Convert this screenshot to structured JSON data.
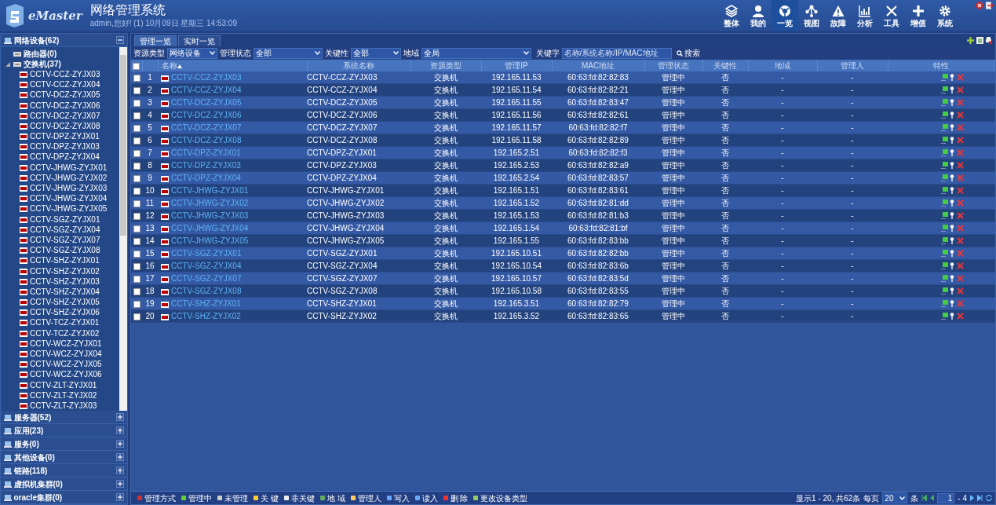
{
  "header": {
    "logo_text": "eMaster",
    "title": "网络管理系统",
    "subtitle": "admin,您好! (1) 10月09日 星期三 14:53:09",
    "nav": [
      {
        "label": "整体",
        "selected": false
      },
      {
        "label": "我的",
        "selected": false
      },
      {
        "label": "一览",
        "selected": true
      },
      {
        "label": "视图",
        "selected": false
      },
      {
        "label": "故障",
        "selected": false
      },
      {
        "label": "分析",
        "selected": false
      },
      {
        "label": "工具",
        "selected": false
      },
      {
        "label": "增值",
        "selected": false
      },
      {
        "label": "系统",
        "selected": false
      }
    ]
  },
  "sidebar": {
    "groups": [
      {
        "label": "网络设备(62)",
        "expanded": true,
        "children": [
          {
            "label": "路由器(0)",
            "expanded": false
          },
          {
            "label": "交换机(37)",
            "expanded": true,
            "children": [
              "CCTV-CCZ-ZYJX03",
              "CCTV-CCZ-ZYJX04",
              "CCTV-DCZ-ZYJX05",
              "CCTV-DCZ-ZYJX06",
              "CCTV-DCZ-ZYJX07",
              "CCTV-DCZ-ZYJX08",
              "CCTV-DPZ-ZYJX01",
              "CCTV-DPZ-ZYJX03",
              "CCTV-DPZ-ZYJX04",
              "CCTV-JHWG-ZYJX01",
              "CCTV-JHWG-ZYJX02",
              "CCTV-JHWG-ZYJX03",
              "CCTV-JHWG-ZYJX04",
              "CCTV-JHWG-ZYJX05",
              "CCTV-SGZ-ZYJX01",
              "CCTV-SGZ-ZYJX04",
              "CCTV-SGZ-ZYJX07",
              "CCTV-SGZ-ZYJX08",
              "CCTV-SHZ-ZYJX01",
              "CCTV-SHZ-ZYJX02",
              "CCTV-SHZ-ZYJX03",
              "CCTV-SHZ-ZYJX04",
              "CCTV-SHZ-ZYJX05",
              "CCTV-SHZ-ZYJX06",
              "CCTV-TCZ-ZYJX01",
              "CCTV-TCZ-ZYJX02",
              "CCTV-WCZ-ZYJX01",
              "CCTV-WCZ-ZYJX04",
              "CCTV-WCZ-ZYJX05",
              "CCTV-WCZ-ZYJX06",
              "CCTV-ZLT-ZYJX01",
              "CCTV-ZLT-ZYJX02",
              "CCTV-ZLT-ZYJX03"
            ]
          }
        ]
      },
      {
        "label": "服务器(52)",
        "expanded": false
      },
      {
        "label": "应用(23)",
        "expanded": false
      },
      {
        "label": "服务(0)",
        "expanded": false
      },
      {
        "label": "其他设备(0)",
        "expanded": false
      },
      {
        "label": "链路(118)",
        "expanded": false
      },
      {
        "label": "虚拟机集群(0)",
        "expanded": false
      },
      {
        "label": "oracle集群(0)",
        "expanded": false
      }
    ]
  },
  "tabs": [
    {
      "label": "管理一览",
      "selected": true
    },
    {
      "label": "实时一览",
      "selected": false
    }
  ],
  "filters": [
    {
      "label": "资源类型",
      "value": "网络设备"
    },
    {
      "label": "管理状态",
      "value": "全部"
    },
    {
      "label": "关键性",
      "value": "全部"
    },
    {
      "label": "地域",
      "value": "全局"
    }
  ],
  "keyword": {
    "label": "关键字",
    "placeholder": "名称/系统名称/IP/MAC地址"
  },
  "search_button": "搜索",
  "table": {
    "select_all_checked": false,
    "columns": [
      "名称",
      "系统名称",
      "资源类型",
      "管理IP",
      "MAC地址",
      "管理状态",
      "关键性",
      "地域",
      "管理人",
      "特性"
    ],
    "rows": [
      {
        "no": "1",
        "name": "CCTV-CCZ-ZYJX03",
        "sysname": "CCTV-CCZ-ZYJX03",
        "type": "交换机",
        "ip": "192.165.11.53",
        "mac": "60:63:fd:82:82:83",
        "state": "管理中",
        "key": "否",
        "region": "-",
        "manager": "-",
        "checked": false
      },
      {
        "no": "2",
        "name": "CCTV-CCZ-ZYJX04",
        "sysname": "CCTV-CCZ-ZYJX04",
        "type": "交换机",
        "ip": "192.165.11.54",
        "mac": "60:63:fd:82:82:21",
        "state": "管理中",
        "key": "否",
        "region": "-",
        "manager": "-",
        "checked": false
      },
      {
        "no": "3",
        "name": "CCTV-DCZ-ZYJX05",
        "sysname": "CCTV-DCZ-ZYJX05",
        "type": "交换机",
        "ip": "192.165.11.55",
        "mac": "60:63:fd:82:83:47",
        "state": "管理中",
        "key": "否",
        "region": "-",
        "manager": "-",
        "checked": false
      },
      {
        "no": "4",
        "name": "CCTV-DCZ-ZYJX06",
        "sysname": "CCTV-DCZ-ZYJX06",
        "type": "交换机",
        "ip": "192.165.11.56",
        "mac": "60:63:fd:82:82:61",
        "state": "管理中",
        "key": "否",
        "region": "-",
        "manager": "-",
        "checked": false
      },
      {
        "no": "5",
        "name": "CCTV-DCZ-ZYJX07",
        "sysname": "CCTV-DCZ-ZYJX07",
        "type": "交换机",
        "ip": "192.165.11.57",
        "mac": "60:63:fd:82:82:f7",
        "state": "管理中",
        "key": "否",
        "region": "-",
        "manager": "-",
        "checked": false
      },
      {
        "no": "6",
        "name": "CCTV-DCZ-ZYJX08",
        "sysname": "CCTV-DCZ-ZYJX08",
        "type": "交换机",
        "ip": "192.165.11.58",
        "mac": "60:63:fd:82:82:89",
        "state": "管理中",
        "key": "否",
        "region": "-",
        "manager": "-",
        "checked": false
      },
      {
        "no": "7",
        "name": "CCTV-DPZ-ZYJX01",
        "sysname": "CCTV-DPZ-ZYJX01",
        "type": "交换机",
        "ip": "192.165.2.51",
        "mac": "60:63:fd:82:82:f3",
        "state": "管理中",
        "key": "否",
        "region": "-",
        "manager": "-",
        "checked": false
      },
      {
        "no": "8",
        "name": "CCTV-DPZ-ZYJX03",
        "sysname": "CCTV-DPZ-ZYJX03",
        "type": "交换机",
        "ip": "192.165.2.53",
        "mac": "60:63:fd:82:82:a9",
        "state": "管理中",
        "key": "否",
        "region": "-",
        "manager": "-",
        "checked": false
      },
      {
        "no": "9",
        "name": "CCTV-DPZ-ZYJX04",
        "sysname": "CCTV-DPZ-ZYJX04",
        "type": "交换机",
        "ip": "192.165.2.54",
        "mac": "60:63:fd:82:83:57",
        "state": "管理中",
        "key": "否",
        "region": "-",
        "manager": "-",
        "checked": false
      },
      {
        "no": "10",
        "name": "CCTV-JHWG-ZYJX01",
        "sysname": "CCTV-JHWG-ZYJX01",
        "type": "交换机",
        "ip": "192.165.1.51",
        "mac": "60:63:fd:82:83:61",
        "state": "管理中",
        "key": "否",
        "region": "-",
        "manager": "-",
        "checked": false
      },
      {
        "no": "11",
        "name": "CCTV-JHWG-ZYJX02",
        "sysname": "CCTV-JHWG-ZYJX02",
        "type": "交换机",
        "ip": "192.165.1.52",
        "mac": "60:63:fd:82:81:dd",
        "state": "管理中",
        "key": "否",
        "region": "-",
        "manager": "-",
        "checked": false
      },
      {
        "no": "12",
        "name": "CCTV-JHWG-ZYJX03",
        "sysname": "CCTV-JHWG-ZYJX03",
        "type": "交换机",
        "ip": "192.165.1.53",
        "mac": "60:63:fd:82:81:b3",
        "state": "管理中",
        "key": "否",
        "region": "-",
        "manager": "-",
        "checked": false
      },
      {
        "no": "13",
        "name": "CCTV-JHWG-ZYJX04",
        "sysname": "CCTV-JHWG-ZYJX04",
        "type": "交换机",
        "ip": "192.165.1.54",
        "mac": "60:63:fd:82:81:bf",
        "state": "管理中",
        "key": "否",
        "region": "-",
        "manager": "-",
        "checked": false
      },
      {
        "no": "14",
        "name": "CCTV-JHWG-ZYJX05",
        "sysname": "CCTV-JHWG-ZYJX05",
        "type": "交换机",
        "ip": "192.165.1.55",
        "mac": "60:63:fd:82:83:bb",
        "state": "管理中",
        "key": "否",
        "region": "-",
        "manager": "-",
        "checked": false
      },
      {
        "no": "15",
        "name": "CCTV-SGZ-ZYJX01",
        "sysname": "CCTV-SGZ-ZYJX01",
        "type": "交换机",
        "ip": "192.165.10.51",
        "mac": "60:63:fd:82:82:bb",
        "state": "管理中",
        "key": "否",
        "region": "-",
        "manager": "-",
        "checked": false
      },
      {
        "no": "16",
        "name": "CCTV-SGZ-ZYJX04",
        "sysname": "CCTV-SGZ-ZYJX04",
        "type": "交换机",
        "ip": "192.165.10.54",
        "mac": "60:63:fd:82:83:6b",
        "state": "管理中",
        "key": "否",
        "region": "-",
        "manager": "-",
        "checked": false
      },
      {
        "no": "17",
        "name": "CCTV-SGZ-ZYJX07",
        "sysname": "CCTV-SGZ-ZYJX07",
        "type": "交换机",
        "ip": "192.165.10.57",
        "mac": "60:63:fd:82:83:5d",
        "state": "管理中",
        "key": "否",
        "region": "-",
        "manager": "-",
        "checked": false
      },
      {
        "no": "18",
        "name": "CCTV-SGZ-ZYJX08",
        "sysname": "CCTV-SGZ-ZYJX08",
        "type": "交换机",
        "ip": "192.165.10.58",
        "mac": "60:63:fd:82:83:55",
        "state": "管理中",
        "key": "否",
        "region": "-",
        "manager": "-",
        "checked": false
      },
      {
        "no": "19",
        "name": "CCTV-SHZ-ZYJX01",
        "sysname": "CCTV-SHZ-ZYJX01",
        "type": "交换机",
        "ip": "192.165.3.51",
        "mac": "60:63:fd:82:82:79",
        "state": "管理中",
        "key": "否",
        "region": "-",
        "manager": "-",
        "checked": false
      },
      {
        "no": "20",
        "name": "CCTV-SHZ-ZYJX02",
        "sysname": "CCTV-SHZ-ZYJX02",
        "type": "交换机",
        "ip": "192.165.3.52",
        "mac": "60:63:fd:82:83:65",
        "state": "管理中",
        "key": "否",
        "region": "-",
        "manager": "-",
        "checked": false
      }
    ]
  },
  "actions": [
    "管理方式",
    "管理中",
    "未管理",
    "关 键",
    "非关键",
    "地 域",
    "管理人",
    "写入",
    "读入",
    "删 除",
    "更改设备类型"
  ],
  "pager": {
    "summary": "显示1 - 20, 共62条",
    "per_page_label": "每页",
    "per_page": "20",
    "unit": "条",
    "page": "1",
    "total": "- 4"
  }
}
